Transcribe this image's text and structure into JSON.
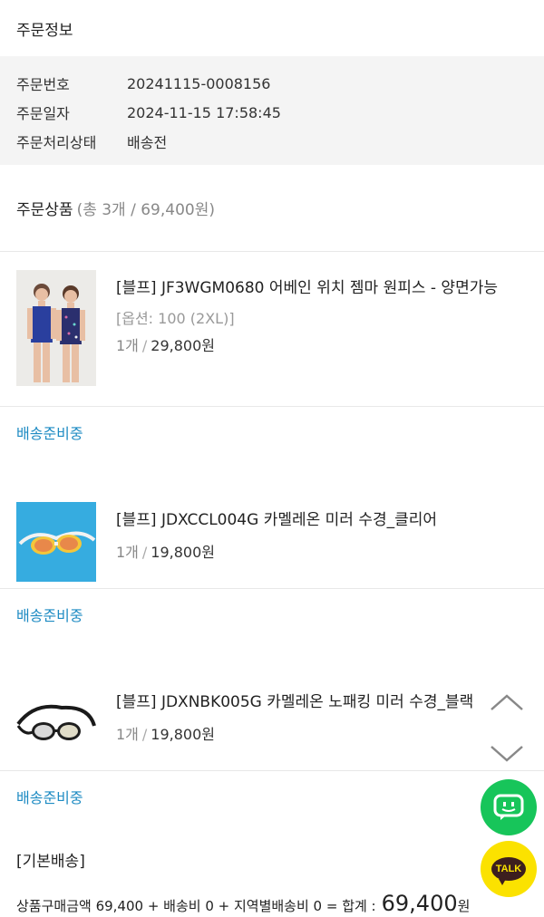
{
  "order_info": {
    "title": "주문정보",
    "rows": [
      {
        "label": "주문번호",
        "value": "20241115-0008156"
      },
      {
        "label": "주문일자",
        "value": "2024-11-15 17:58:45"
      },
      {
        "label": "주문처리상태",
        "value": "배송전"
      }
    ]
  },
  "products": {
    "title": "주문상품",
    "count_text": "(총 3개 / 69,400원)",
    "items": [
      {
        "name": "[블프] JF3WGM0680 어베인 위치 젬마 원피스 - 양면가능",
        "option": "[옵션: 100 (2XL)]",
        "qty": "1개",
        "price": "29,800원",
        "status": "배송준비중"
      },
      {
        "name": "[블프] JDXCCL004G 카멜레온 미러 수경_클리어",
        "option": "",
        "qty": "1개",
        "price": "19,800원",
        "status": "배송준비중"
      },
      {
        "name": "[블프] JDXNBK005G 카멜레온 노패킹 미러 수경_블랙",
        "option": "",
        "qty": "1개",
        "price": "19,800원",
        "status": "배송준비중"
      }
    ]
  },
  "shipping": {
    "title": "[기본배송]",
    "summary_text": "상품구매금액 69,400 + 배송비 0 + 지역별배송비 0 = 합계 :",
    "total": "69,400",
    "won": "원"
  },
  "floating": {
    "talk_label": "TALK",
    "colors": {
      "chat": "#17c55a",
      "talk": "#fbe200"
    }
  },
  "icons": [
    "chevron-up-icon",
    "chevron-down-icon",
    "chat-icon",
    "kakao-talk-icon"
  ]
}
